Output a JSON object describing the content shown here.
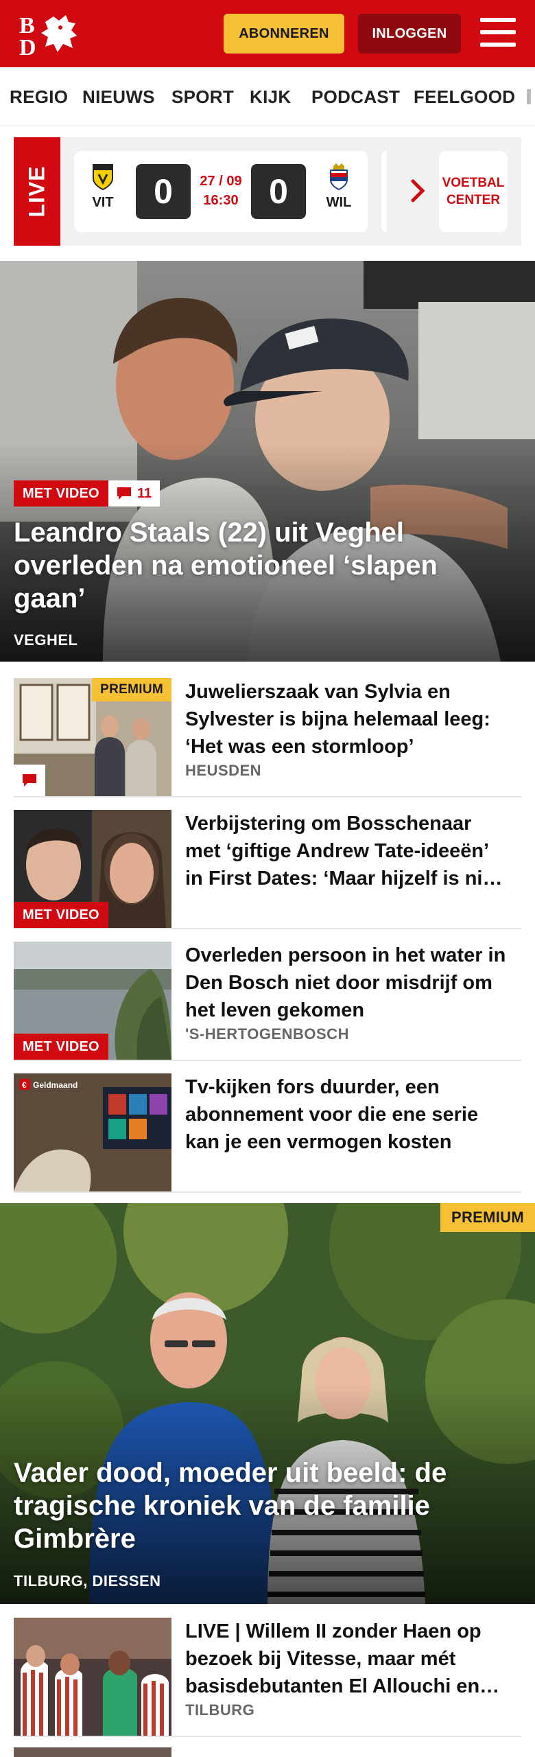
{
  "header": {
    "logo_text": "BD",
    "subscribe_label": "ABONNEREN",
    "login_label": "INLOGGEN",
    "menu_icon": "hamburger-icon",
    "brand_color": "#d10a11"
  },
  "nav": {
    "items": [
      "REGIO",
      "NIEUWS",
      "SPORT",
      "KIJK",
      "PODCAST",
      "FEELGOOD"
    ]
  },
  "live": {
    "tag": "LIVE",
    "home_team": "VIT",
    "away_team": "WIL",
    "home_score": "0",
    "away_score": "0",
    "date": "27 / 09",
    "time": "16:30",
    "center_label": "VOETBAL CENTER"
  },
  "hero": {
    "badge": "MET VIDEO",
    "comments": "11",
    "title": "Leandro Staals (22) uit Veghel overleden na emotioneel ‘slapen gaan’",
    "location": "VEGHEL"
  },
  "articles": [
    {
      "title": "Juwelierszaak van Sylvia en Sylvester is bijna helemaal leeg: ‘Het was een stormloop’",
      "location": "HEUSDEN",
      "badge": "PREMIUM"
    },
    {
      "title": "Verbijstering om Bosschenaar met ‘giftige Andrew Tate-ideeën’ in First Dates: ‘Maar hijzelf is ni…",
      "location": "",
      "badge": "MET VIDEO"
    },
    {
      "title": "Overleden persoon in het water in Den Bosch niet door misdrijf om het leven gekomen",
      "location": "'S-HERTOGENBOSCH",
      "badge": "MET VIDEO"
    },
    {
      "title": "Tv-kijken fors duurder, een abonnement voor die ene serie kan je een vermogen kosten",
      "location": "",
      "badge": "",
      "thumb_label": "Geldmaand"
    }
  ],
  "feature": {
    "badge": "PREMIUM",
    "title": "Vader dood, moeder uit beeld: de tragische kroniek van de familie Gimbrère",
    "location": "TILBURG, DIESSEN"
  },
  "article_bottom": {
    "title": "LIVE | Willem II zonder Haen op bezoek bij Vitesse, maar mét basisdebutanten El Allouchi en…",
    "location": "TILBURG"
  }
}
